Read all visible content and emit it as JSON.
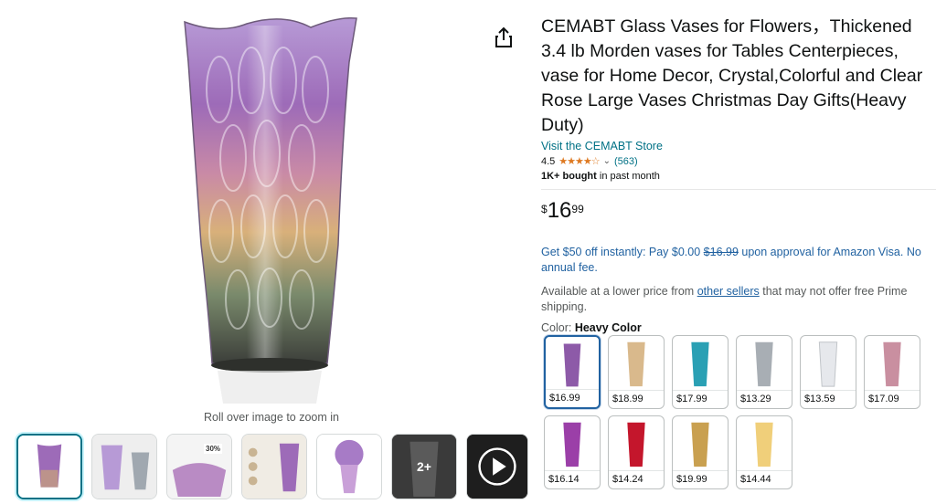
{
  "product": {
    "title": "CEMABT Glass Vases for Flowers，Thickened 3.4 lb Morden vases for Tables Centerpieces, vase for Home Decor, Crystal,Colorful and Clear Rose Large Vases Christmas Day Gifts(Heavy Duty)",
    "store_link": "Visit the CEMABT Store",
    "rating": "4.5",
    "stars_glyph": "★★★★☆",
    "review_count": "(563)",
    "bought_strong": "1K+ bought",
    "bought_rest": " in past month"
  },
  "price": {
    "symbol": "$",
    "whole": "16",
    "fraction": "99"
  },
  "promo": {
    "prefix": "Get $50 off instantly: Pay $0.00 ",
    "strike": "$16.99",
    "suffix": " upon approval for Amazon Visa. No annual fee."
  },
  "availability": {
    "prefix": "Available at a lower price from ",
    "link": "other sellers",
    "suffix": " that may not offer free Prime shipping."
  },
  "color": {
    "label": "Color: ",
    "selected": "Heavy Color"
  },
  "gallery": {
    "zoom_hint": "Roll over image to zoom in",
    "more_label": "2+",
    "thickness_tag": "30%"
  },
  "swatches": [
    {
      "price": "$16.99",
      "color": "#8d5aa8"
    },
    {
      "price": "$18.99",
      "color": "#d9b98c"
    },
    {
      "price": "$17.99",
      "color": "#2aa0b4"
    },
    {
      "price": "$13.29",
      "color": "#a8aeb4"
    },
    {
      "price": "$13.59",
      "color": "#e6e8ec"
    },
    {
      "price": "$17.09",
      "color": "#c98fa0"
    },
    {
      "price": "$16.14",
      "color": "#9b3fa8"
    },
    {
      "price": "$14.24",
      "color": "#c4162c"
    },
    {
      "price": "$19.99",
      "color": "#c9a050"
    },
    {
      "price": "$14.44",
      "color": "#f0cf7a"
    }
  ]
}
